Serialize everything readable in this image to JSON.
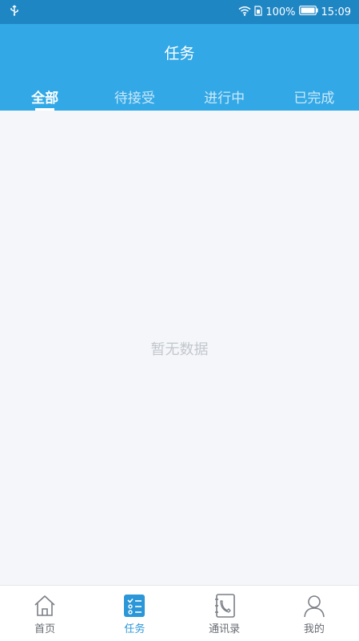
{
  "status_bar": {
    "battery": "100%",
    "time": "15:09",
    "icons": [
      "usb-icon",
      "wifi-icon",
      "sim-icon",
      "battery-icon"
    ]
  },
  "header": {
    "title": "任务",
    "tabs": [
      {
        "label": "全部",
        "active": true
      },
      {
        "label": "待接受",
        "active": false
      },
      {
        "label": "进行中",
        "active": false
      },
      {
        "label": "已完成",
        "active": false
      }
    ]
  },
  "main": {
    "empty_text": "暂无数据"
  },
  "bottom_nav": {
    "items": [
      {
        "label": "首页",
        "icon": "home-icon",
        "active": false
      },
      {
        "label": "任务",
        "icon": "task-list-icon",
        "active": true
      },
      {
        "label": "通讯录",
        "icon": "contacts-book-icon",
        "active": false
      },
      {
        "label": "我的",
        "icon": "profile-icon",
        "active": false
      }
    ]
  },
  "colors": {
    "header": "#32a8e6",
    "status_bar": "#1f86c4",
    "active_nav": "#2b97d8",
    "background": "#f4f6fa"
  }
}
